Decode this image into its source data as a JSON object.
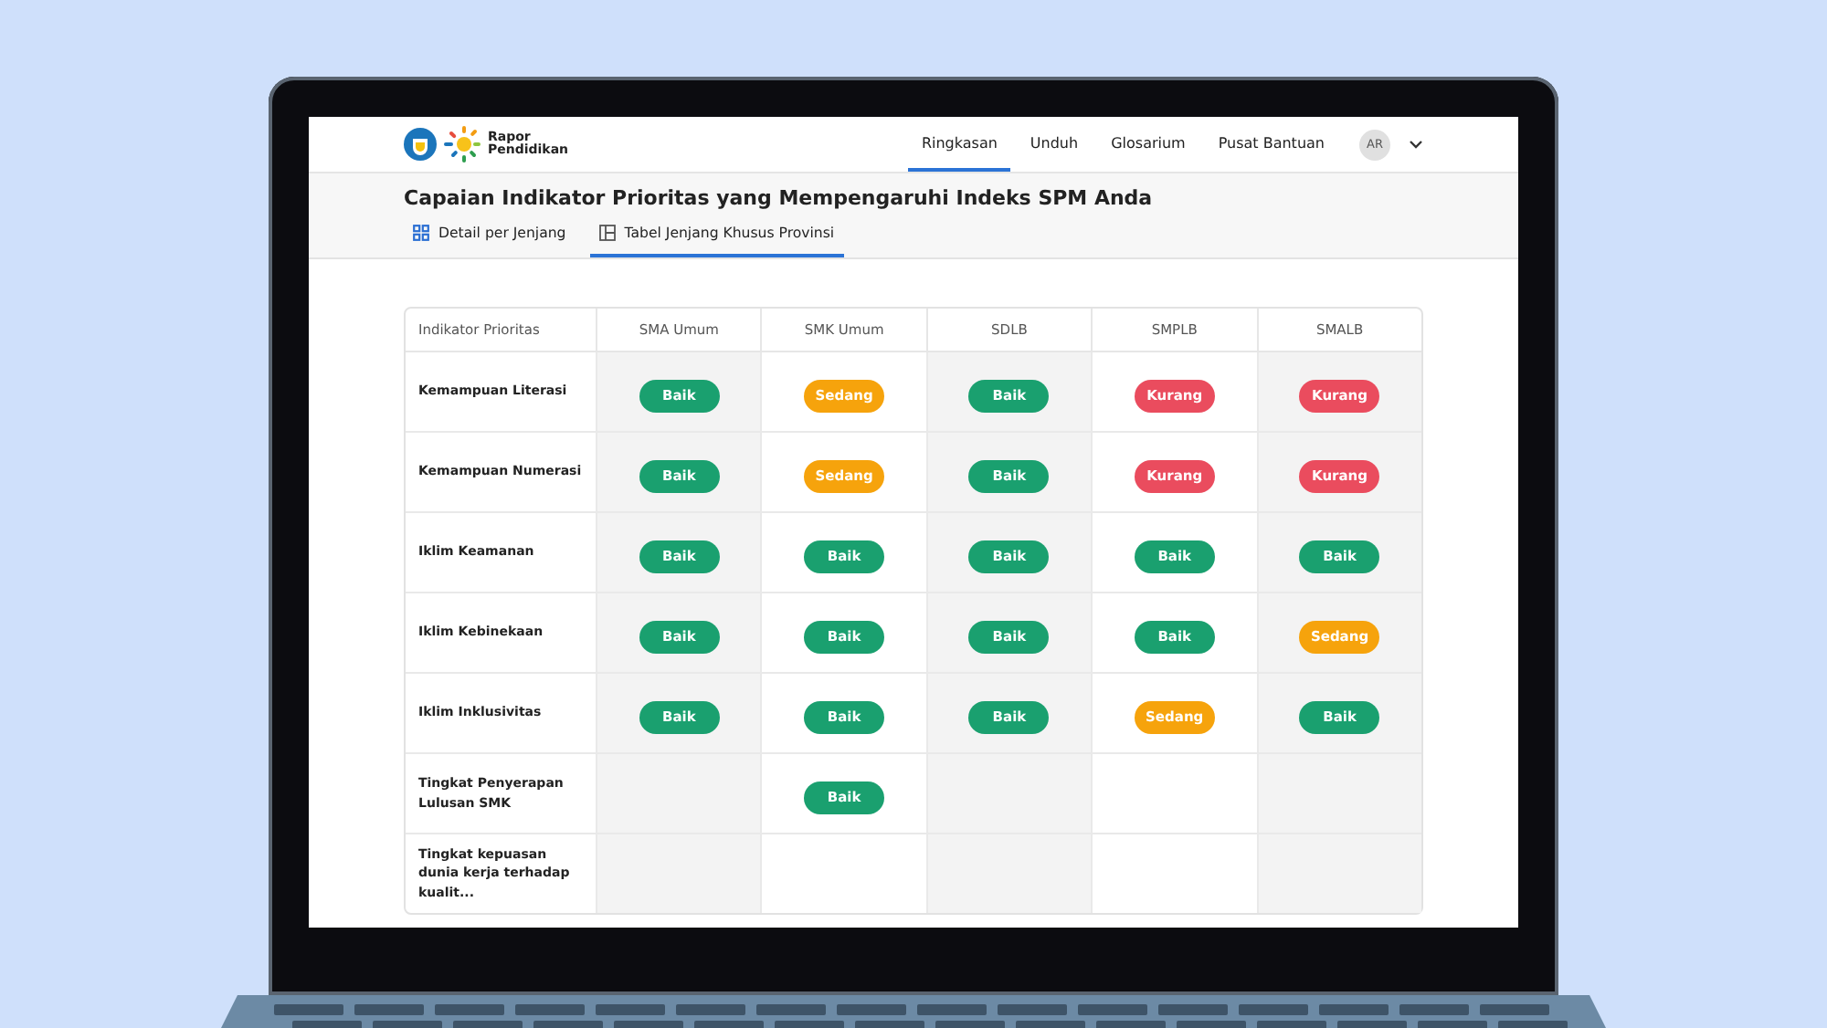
{
  "brand": {
    "name": "Rapor Pendidikan"
  },
  "nav": [
    {
      "label": "Ringkasan",
      "selected": true
    },
    {
      "label": "Unduh",
      "selected": false
    },
    {
      "label": "Glosarium",
      "selected": false
    },
    {
      "label": "Pusat Bantuan",
      "selected": false
    }
  ],
  "user": {
    "initials": "AR"
  },
  "page_title": "Capaian Indikator Prioritas yang Mempengaruhi Indeks SPM Anda",
  "tabs": [
    {
      "label": "Detail per Jenjang",
      "kind": "grid",
      "selected": false
    },
    {
      "label": "Tabel Jenjang Khusus Provinsi",
      "kind": "table",
      "selected": true
    }
  ],
  "table": {
    "columns": [
      "Indikator Prioritas",
      "SMA Umum",
      "SMK Umum",
      "SDLB",
      "SMPLB",
      "SMALB"
    ],
    "rows": [
      [
        "Kemampuan Literasi",
        {
          "kind": "good",
          "text": "Baik"
        },
        {
          "kind": "medium",
          "text": "Sedang"
        },
        {
          "kind": "good",
          "text": "Baik"
        },
        {
          "kind": "poor",
          "text": "Kurang"
        },
        {
          "kind": "poor",
          "text": "Kurang"
        }
      ],
      [
        "Kemampuan Numerasi",
        {
          "kind": "good",
          "text": "Baik"
        },
        {
          "kind": "medium",
          "text": "Sedang"
        },
        {
          "kind": "good",
          "text": "Baik"
        },
        {
          "kind": "poor",
          "text": "Kurang"
        },
        {
          "kind": "poor",
          "text": "Kurang"
        }
      ],
      [
        "Iklim Keamanan",
        {
          "kind": "good",
          "text": "Baik"
        },
        {
          "kind": "good",
          "text": "Baik"
        },
        {
          "kind": "good",
          "text": "Baik"
        },
        {
          "kind": "good",
          "text": "Baik"
        },
        {
          "kind": "good",
          "text": "Baik"
        }
      ],
      [
        "Iklim Kebinekaan",
        {
          "kind": "good",
          "text": "Baik"
        },
        {
          "kind": "good",
          "text": "Baik"
        },
        {
          "kind": "good",
          "text": "Baik"
        },
        {
          "kind": "good",
          "text": "Baik"
        },
        {
          "kind": "medium",
          "text": "Sedang"
        }
      ],
      [
        "Iklim Inklusivitas",
        {
          "kind": "good",
          "text": "Baik"
        },
        {
          "kind": "good",
          "text": "Baik"
        },
        {
          "kind": "good",
          "text": "Baik"
        },
        {
          "kind": "medium",
          "text": "Sedang"
        },
        {
          "kind": "good",
          "text": "Baik"
        }
      ],
      [
        "Tingkat Penyerapan Lulusan SMK",
        "",
        {
          "kind": "good",
          "text": "Baik"
        },
        "",
        "",
        ""
      ],
      [
        "Tingkat kepuasan dunia kerja terhadap kualit...",
        "",
        "",
        "",
        "",
        ""
      ]
    ]
  }
}
